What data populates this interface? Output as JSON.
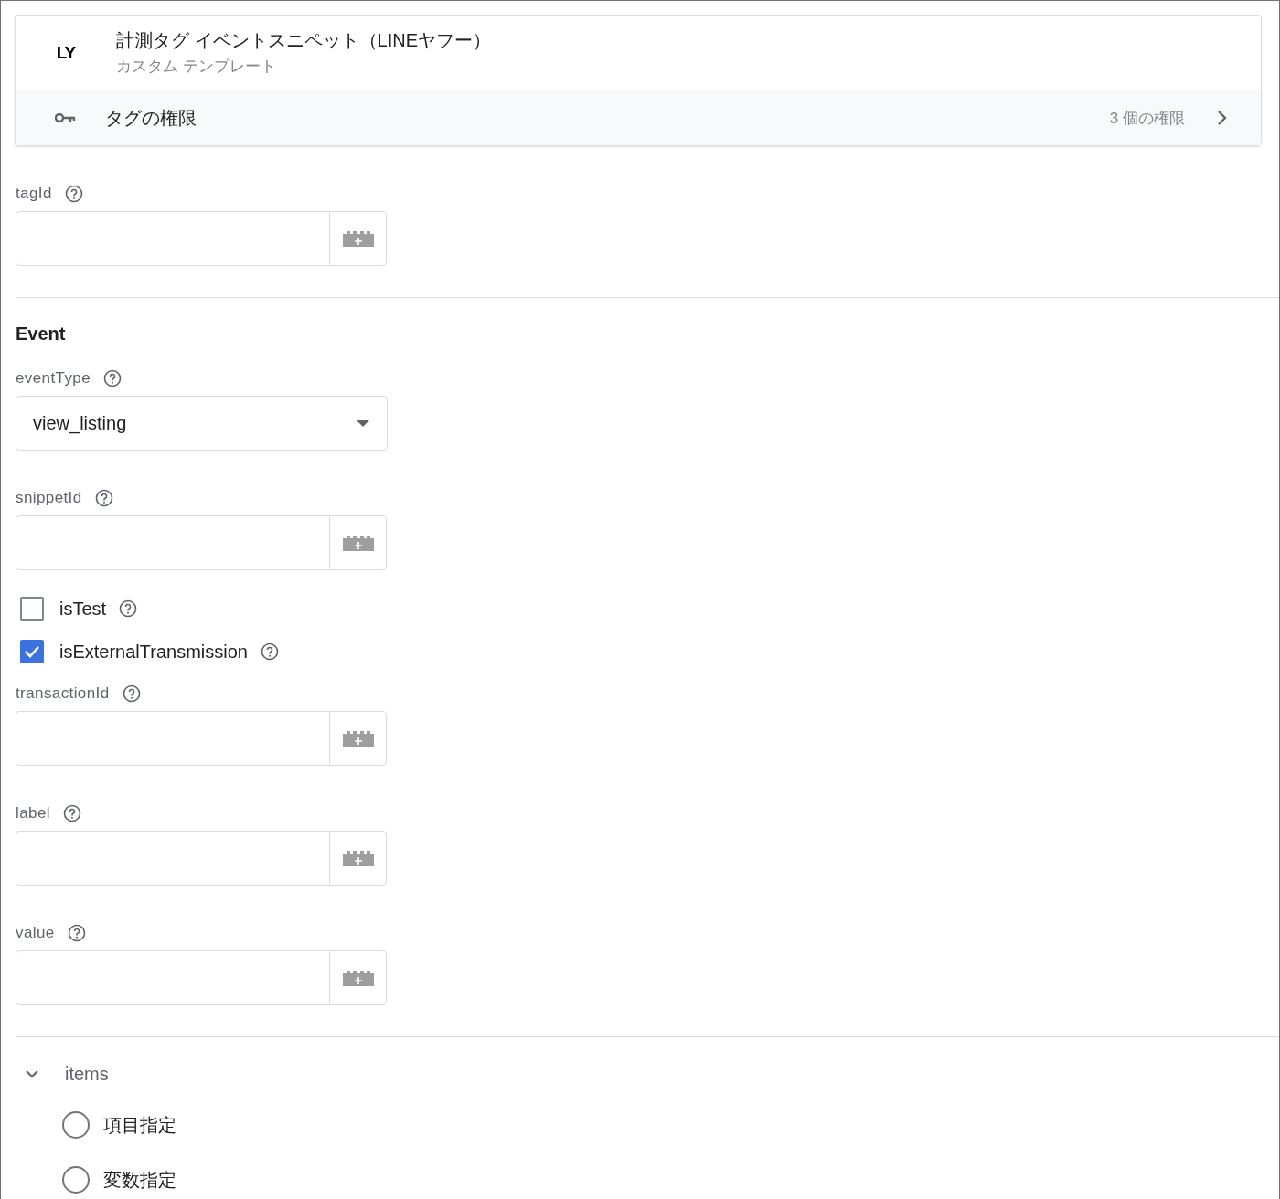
{
  "header": {
    "logo": "LY",
    "title": "計測タグ イベントスニペット（LINEヤフー）",
    "subtitle": "カスタム テンプレート"
  },
  "permissions": {
    "label": "タグの権限",
    "count": "3 個の権限"
  },
  "sections": [
    {
      "fields": [
        {
          "kind": "text",
          "label": "tagId"
        }
      ]
    },
    {
      "title": "Event",
      "fields": [
        {
          "kind": "select",
          "label": "eventType",
          "value": "view_listing"
        },
        {
          "kind": "text",
          "label": "snippetId"
        },
        {
          "kind": "checkbox",
          "label": "isTest",
          "checked": false
        },
        {
          "kind": "checkbox",
          "label": "isExternalTransmission",
          "checked": true
        },
        {
          "kind": "text",
          "label": "transactionId"
        },
        {
          "kind": "text",
          "label": "label"
        },
        {
          "kind": "text",
          "label": "value"
        }
      ]
    },
    {
      "group": {
        "label": "items",
        "expanded": true,
        "options": [
          {
            "label": "項目指定",
            "selected": false
          },
          {
            "label": "変数指定",
            "selected": false
          }
        ]
      }
    }
  ]
}
